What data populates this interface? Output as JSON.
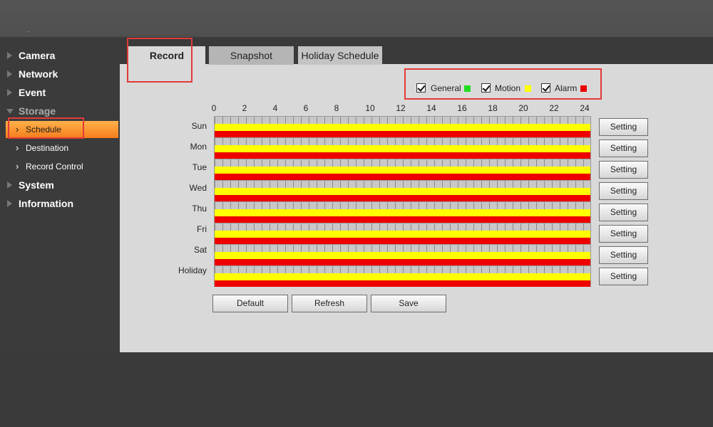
{
  "sidebar": {
    "items": [
      {
        "label": "Camera"
      },
      {
        "label": "Network"
      },
      {
        "label": "Event"
      },
      {
        "label": "Storage"
      },
      {
        "label": "System"
      },
      {
        "label": "Information"
      }
    ],
    "storage_sub": [
      {
        "label": "Schedule"
      },
      {
        "label": "Destination"
      },
      {
        "label": "Record Control"
      }
    ]
  },
  "tabs": [
    {
      "label": "Record"
    },
    {
      "label": "Snapshot"
    },
    {
      "label": "Holiday Schedule"
    }
  ],
  "legend": [
    {
      "label": "General",
      "color": "#22dd22",
      "checked": true
    },
    {
      "label": "Motion",
      "color": "#ffff00",
      "checked": true
    },
    {
      "label": "Alarm",
      "color": "#ee0000",
      "checked": true
    }
  ],
  "hours": [
    "0",
    "2",
    "4",
    "6",
    "8",
    "10",
    "12",
    "14",
    "16",
    "18",
    "20",
    "22",
    "24"
  ],
  "days": [
    {
      "label": "Sun",
      "button": "Setting"
    },
    {
      "label": "Mon",
      "button": "Setting"
    },
    {
      "label": "Tue",
      "button": "Setting"
    },
    {
      "label": "Wed",
      "button": "Setting"
    },
    {
      "label": "Thu",
      "button": "Setting"
    },
    {
      "label": "Fri",
      "button": "Setting"
    },
    {
      "label": "Sat",
      "button": "Setting"
    },
    {
      "label": "Holiday",
      "button": "Setting"
    }
  ],
  "actions": {
    "default_label": "Default",
    "refresh_label": "Refresh",
    "save_label": "Save"
  }
}
